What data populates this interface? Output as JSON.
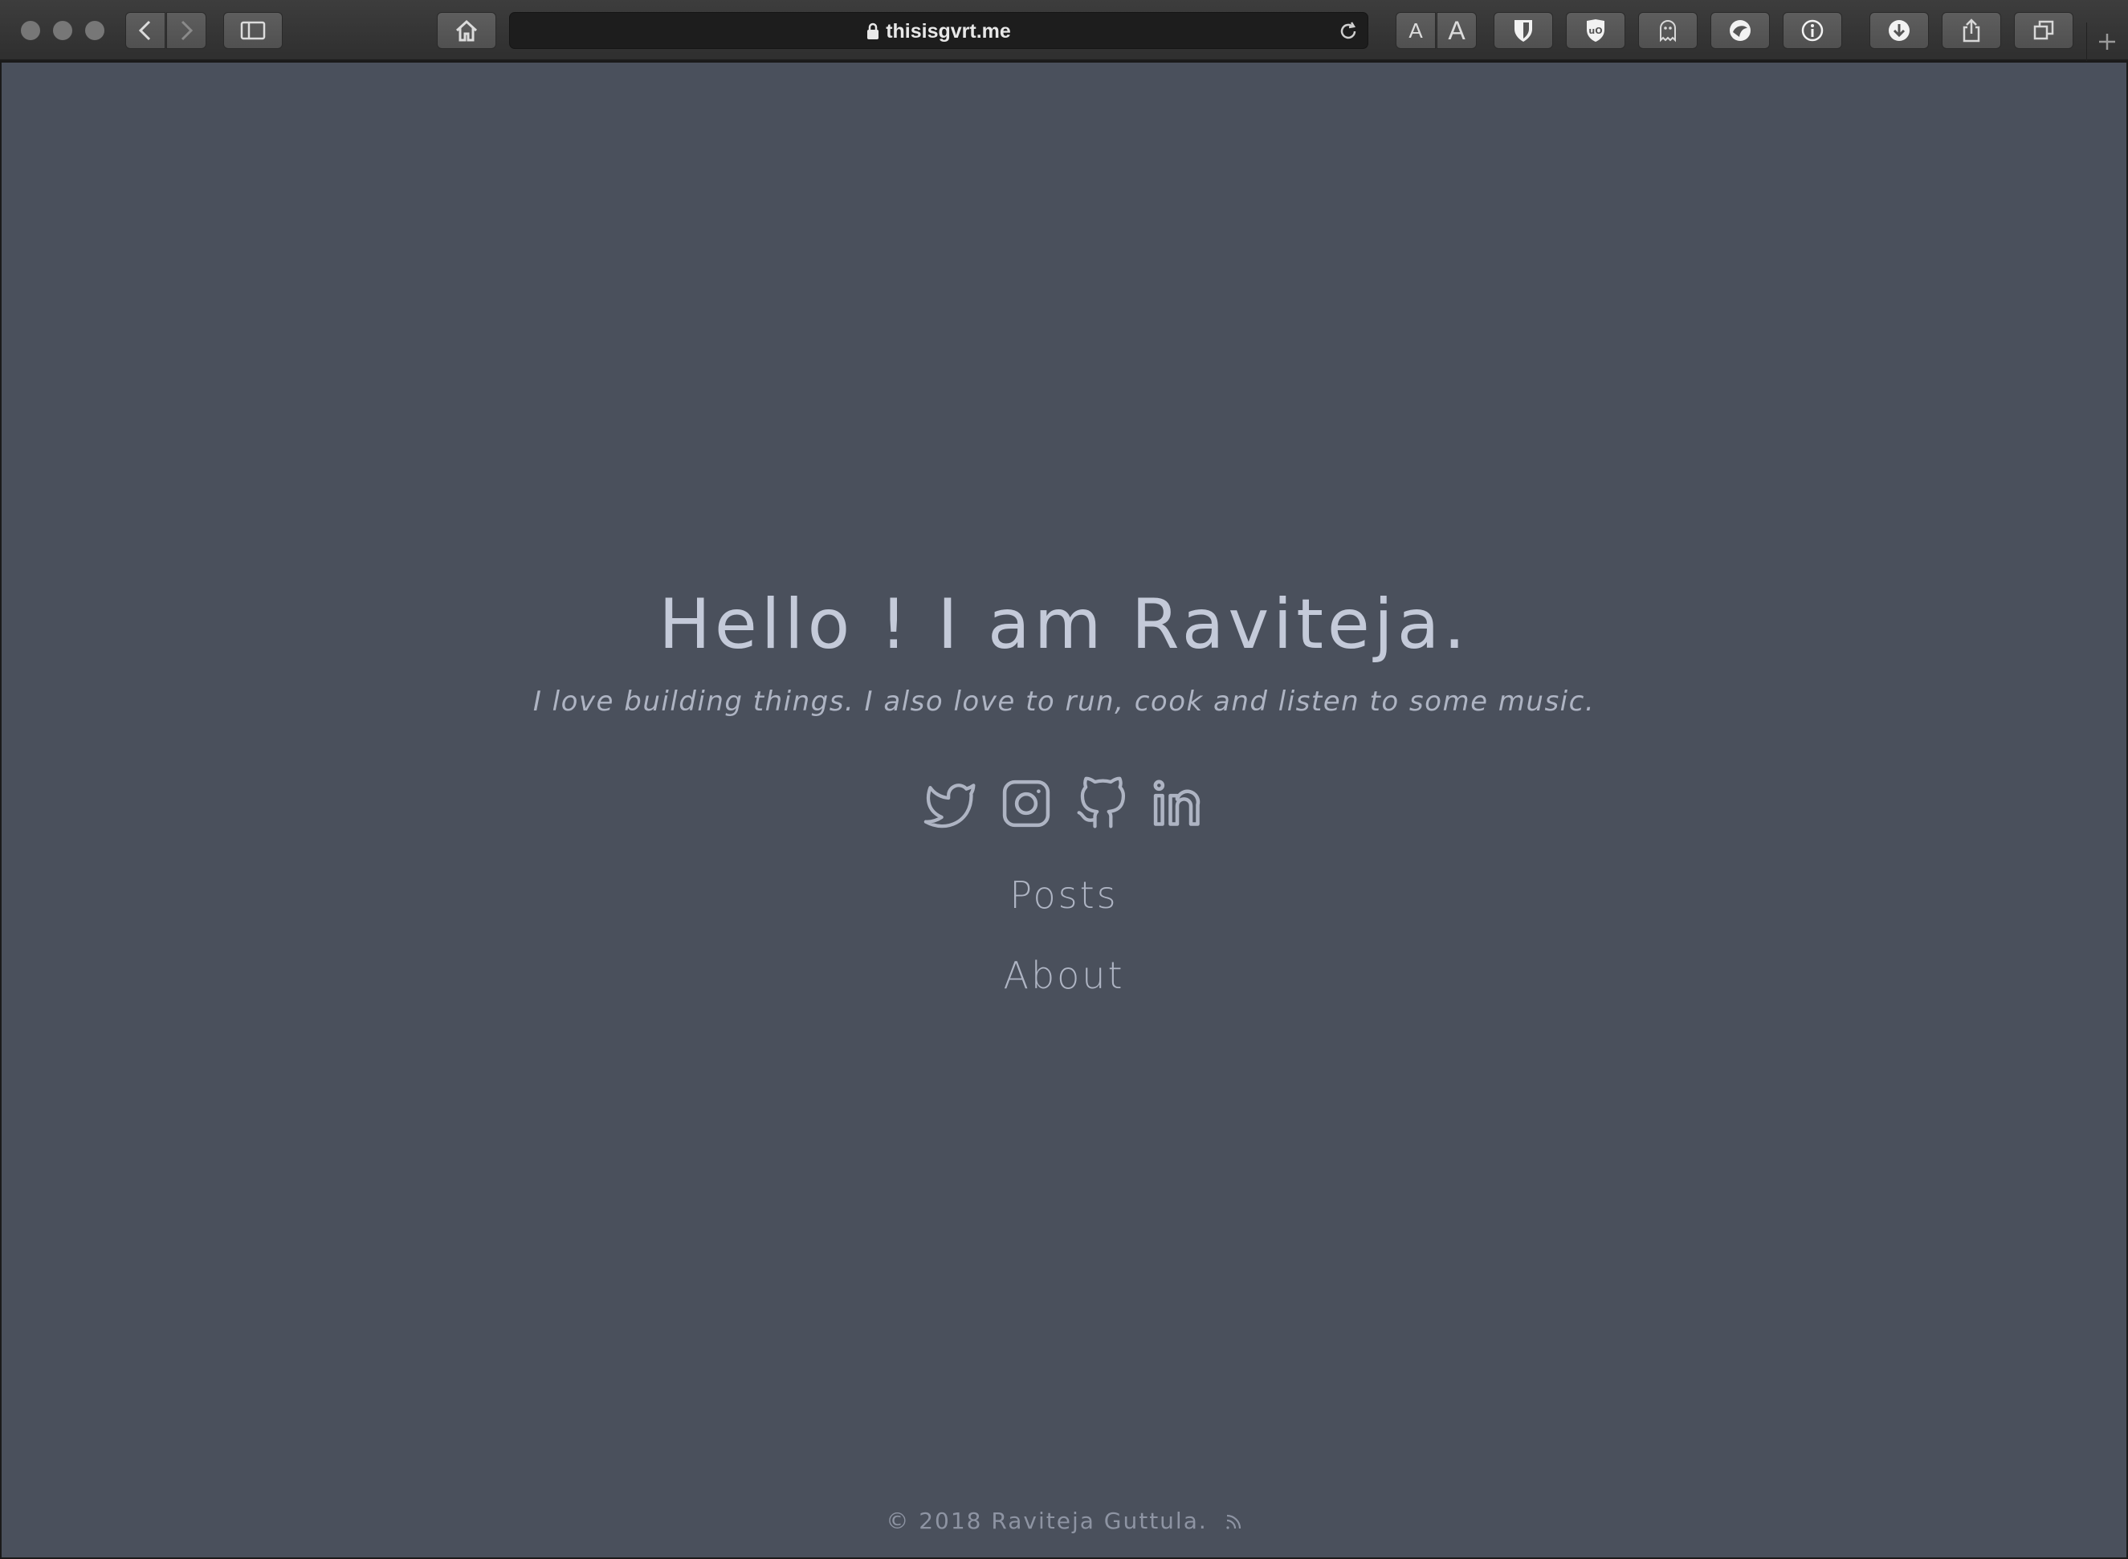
{
  "browser": {
    "url": "thisisgvrt.me",
    "font_small_label": "A",
    "font_large_label": "A",
    "icons": [
      "back-icon",
      "forward-icon",
      "sidebar-icon",
      "home-icon",
      "lock-icon",
      "reload-icon",
      "shield-icon",
      "ublock-icon",
      "ghostery-icon",
      "extension-icon",
      "info-icon",
      "download-icon",
      "share-icon",
      "tabs-icon",
      "plus-icon"
    ]
  },
  "hero": {
    "title": "Hello ! I am Raviteja.",
    "tagline": "I love building things. I also love to run, cook and listen to some music."
  },
  "socials": [
    "twitter-icon",
    "instagram-icon",
    "github-icon",
    "linkedin-icon"
  ],
  "nav": {
    "posts": "Posts",
    "about": "About"
  },
  "footer": {
    "text": "© 2018 Raviteja Guttula."
  },
  "colors": {
    "page_background": "#4a505c",
    "text": "#b7bdcc",
    "toolbar": "#353535"
  }
}
